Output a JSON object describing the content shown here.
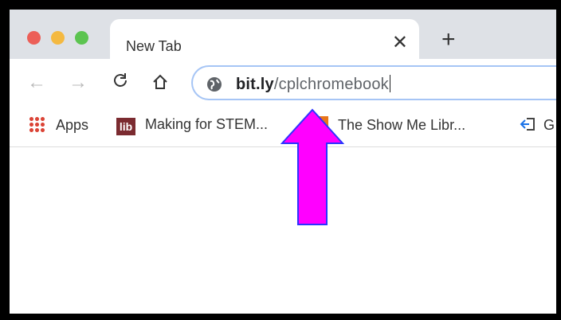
{
  "tab": {
    "title": "New Tab",
    "close_glyph": "✕",
    "new_tab_glyph": "+"
  },
  "toolbar": {
    "back_glyph": "←",
    "forward_glyph": "→",
    "reload_glyph": "C",
    "address": {
      "domain": "bit.ly",
      "path": "/cplchromebook"
    }
  },
  "bookmarks": [
    {
      "label": "Apps",
      "icon": "apps-grid-icon"
    },
    {
      "label": "Making for STEM...",
      "icon": "lib-icon"
    },
    {
      "label": "The Show Me Libr...",
      "icon": "show-me-icon"
    },
    {
      "label": "G",
      "icon": "sign-in-icon"
    }
  ],
  "annotation": {
    "arrow_color": "#ff00ff",
    "arrow_border": "#2b33ff"
  },
  "colors": {
    "titlebar": "#dee1e6",
    "traffic_red": "#ec5f58",
    "traffic_yellow": "#f4b941",
    "traffic_green": "#5cc450",
    "omnibox_focus": "#a6c5f5"
  }
}
